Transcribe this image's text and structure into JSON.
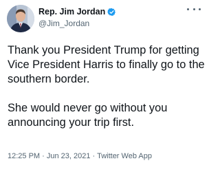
{
  "author": {
    "display_name": "Rep. Jim Jordan",
    "handle": "@Jim_Jordan",
    "verified": true,
    "verified_color": "#1d9bf0",
    "avatar_icon": "profile-photo-icon",
    "menu_icon": "more-options-icon"
  },
  "tweet": {
    "lines_p1": [
      "Thank you President Trump for getting",
      "Vice President Harris to finally go to the",
      "southern border."
    ],
    "lines_p2": [
      "She would never go without you",
      "announcing your trip first."
    ]
  },
  "meta": {
    "time": "12:25 PM",
    "date": "Jun 23, 2021",
    "source": "Twitter Web App",
    "separator": " · "
  }
}
